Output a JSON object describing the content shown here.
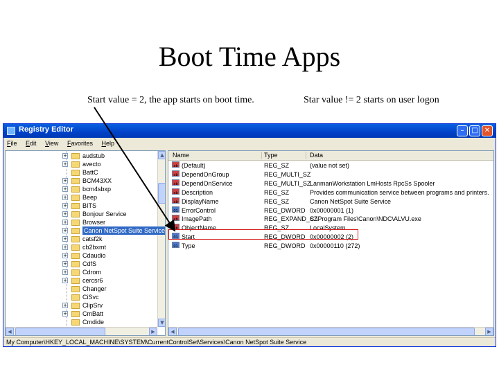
{
  "slide": {
    "title": "Boot Time Apps",
    "caption_left": "Start value = 2, the app starts on boot time.",
    "caption_right": "Star value != 2 starts on user logon"
  },
  "window": {
    "title": "Registry Editor",
    "controls": {
      "minimize": "–",
      "maximize": "□",
      "close": "✕"
    }
  },
  "menu": [
    "File",
    "Edit",
    "View",
    "Favorites",
    "Help"
  ],
  "tree": {
    "items": [
      {
        "label": "audstub",
        "expandable": true
      },
      {
        "label": "avecto",
        "expandable": true
      },
      {
        "label": "BattC",
        "expandable": false
      },
      {
        "label": "BCM43XX",
        "expandable": true
      },
      {
        "label": "bcm4sbxp",
        "expandable": true
      },
      {
        "label": "Beep",
        "expandable": true
      },
      {
        "label": "BITS",
        "expandable": true
      },
      {
        "label": "Bonjour Service",
        "expandable": true
      },
      {
        "label": "Browser",
        "expandable": true
      },
      {
        "label": "Canon NetSpot Suite Service",
        "expandable": true,
        "selected": true
      },
      {
        "label": "catsf2k",
        "expandable": true
      },
      {
        "label": "cb2bxmt",
        "expandable": true
      },
      {
        "label": "Cdaudio",
        "expandable": true
      },
      {
        "label": "CdfS",
        "expandable": true
      },
      {
        "label": "Cdrom",
        "expandable": true
      },
      {
        "label": "cercsr6",
        "expandable": true
      },
      {
        "label": "Changer",
        "expandable": false
      },
      {
        "label": "CiSvc",
        "expandable": false
      },
      {
        "label": "ClipSrv",
        "expandable": true
      },
      {
        "label": "CmBatt",
        "expandable": true
      },
      {
        "label": "Cmdide",
        "expandable": false
      }
    ]
  },
  "values": {
    "columns": [
      "Name",
      "Type",
      "Data"
    ],
    "rows": [
      {
        "icon": "string-value-icon",
        "glyph": "ab",
        "name": "(Default)",
        "type": "REG_SZ",
        "data": "(value not set)"
      },
      {
        "icon": "string-value-icon",
        "glyph": "ab",
        "name": "DependOnGroup",
        "type": "REG_MULTI_SZ",
        "data": ""
      },
      {
        "icon": "string-value-icon",
        "glyph": "ab",
        "name": "DependOnService",
        "type": "REG_MULTI_SZ",
        "data": "LanmanWorkstation LmHosts RpcSs Spooler"
      },
      {
        "icon": "string-value-icon",
        "glyph": "ab",
        "name": "Description",
        "type": "REG_SZ",
        "data": "Provides communication service between programs and printers."
      },
      {
        "icon": "string-value-icon",
        "glyph": "ab",
        "name": "DisplayName",
        "type": "REG_SZ",
        "data": "Canon NetSpot Suite Service"
      },
      {
        "icon": "binary-value-icon",
        "glyph": "01",
        "name": "ErrorControl",
        "type": "REG_DWORD",
        "data": "0x00000001 (1)"
      },
      {
        "icon": "string-value-icon",
        "glyph": "ab",
        "name": "ImagePath",
        "type": "REG_EXPAND_SZ",
        "data": "C:\\Program Files\\Canon\\NDC\\ALVU.exe"
      },
      {
        "icon": "string-value-icon",
        "glyph": "ab",
        "name": "ObjectName",
        "type": "REG_SZ",
        "data": "LocalSystem"
      },
      {
        "icon": "binary-value-icon",
        "glyph": "01",
        "name": "Start",
        "type": "REG_DWORD",
        "data": "0x00000002 (2)"
      },
      {
        "icon": "binary-value-icon",
        "glyph": "01",
        "name": "Type",
        "type": "REG_DWORD",
        "data": "0x00000110 (272)"
      }
    ]
  },
  "statusbar": {
    "path": "My Computer\\HKEY_LOCAL_MACHINE\\SYSTEM\\CurrentControlSet\\Services\\Canon NetSpot Suite Service"
  },
  "colors": {
    "titlebar": "#0a5fe0",
    "selection": "#316ac5",
    "highlight_box": "#d42020"
  }
}
